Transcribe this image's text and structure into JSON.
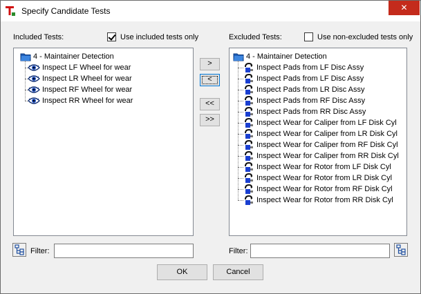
{
  "window": {
    "title": "Specify Candidate Tests",
    "close_glyph": "✕",
    "icon": "app-red-t-icon",
    "accent_color": "#c42b1c"
  },
  "included": {
    "heading": "Included Tests:",
    "checkbox_label": "Use included tests only",
    "checkbox_checked": true,
    "group_label": "4 - Maintainer Detection",
    "items": [
      "Inspect LF Wheel for wear",
      "Inspect LR Wheel for wear",
      "Inspect RF Wheel for wear",
      "Inspect RR Wheel for wear"
    ],
    "filter_label": "Filter:",
    "filter_value": ""
  },
  "excluded": {
    "heading": "Excluded Tests:",
    "checkbox_label": "Use non-excluded tests only",
    "checkbox_checked": false,
    "group_label": "4 - Maintainer Detection",
    "items": [
      "Inspect Pads from LF Disc Assy",
      "Inspect Pads from LF Disc Assy",
      "Inspect Pads from LR Disc Assy",
      "Inspect Pads from RF Disc Assy",
      "Inspect Pads from RR Disc Assy",
      "Inspect Wear for Caliper from LF Disk Cyl",
      "Inspect Wear for Caliper from LR Disk Cyl",
      "Inspect Wear for Caliper from RF Disk Cyl",
      "Inspect Wear for Caliper from RR Disk Cyl",
      "Inspect Wear for Rotor from LF Disk Cyl",
      "Inspect Wear for Rotor from LR Disk Cyl",
      "Inspect Wear for Rotor from RF Disk Cyl",
      "Inspect Wear for Rotor from RR Disk Cyl"
    ],
    "filter_label": "Filter:",
    "filter_value": ""
  },
  "move_buttons": {
    "move_right": ">",
    "move_left": "<",
    "move_all_left": "<<",
    "move_all_right": ">>"
  },
  "footer": {
    "ok_label": "OK",
    "cancel_label": "Cancel"
  },
  "icons": {
    "group": "folder-icon",
    "included_item": "eye-icon",
    "excluded_item": "wrench-tool-icon",
    "filter_toggle": "tree-view-icon"
  }
}
